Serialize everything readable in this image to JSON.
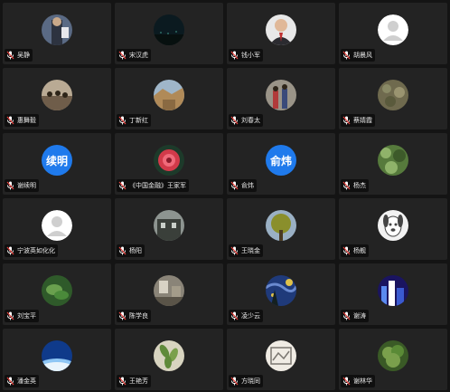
{
  "participants": [
    {
      "name": "吴静",
      "avatar": {
        "type": "photo",
        "icon": "person-photo",
        "bg": "#5a6a84",
        "fg": "#e8e8ec"
      }
    },
    {
      "name": "宋汉虎",
      "avatar": {
        "type": "photo",
        "icon": "night-scene",
        "bg": "#0b1a20",
        "fg": "#2d6b63"
      }
    },
    {
      "name": "钱小军",
      "avatar": {
        "type": "photo",
        "icon": "portrait",
        "bg": "#e8e8e8",
        "fg": "#2b2b30"
      }
    },
    {
      "name": "胡晨风",
      "avatar": {
        "type": "default",
        "icon": "default-person",
        "bg": "#ffffff",
        "fg": "#cfcfcf"
      }
    },
    {
      "name": "惠舞毅",
      "avatar": {
        "type": "photo",
        "icon": "crowd-photo",
        "bg": "#b9aa94",
        "fg": "#6f5d4a"
      }
    },
    {
      "name": "丁新红",
      "avatar": {
        "type": "photo",
        "icon": "landscape",
        "bg": "#9fb6c9",
        "fg": "#b08a58"
      }
    },
    {
      "name": "刘春太",
      "avatar": {
        "type": "photo",
        "icon": "people-photo",
        "bg": "#9a9488",
        "fg": "#b13a3a"
      }
    },
    {
      "name": "蔡婧霞",
      "avatar": {
        "type": "photo",
        "icon": "nature",
        "bg": "#6f6a4e",
        "fg": "#8a8a66"
      }
    },
    {
      "name": "谢续明",
      "avatar": {
        "type": "initials",
        "text": "续明",
        "bg": "#1f7aec",
        "fg": "#ffffff"
      }
    },
    {
      "name": "《中国金融》王家军",
      "avatar": {
        "type": "photo",
        "icon": "flower",
        "bg": "#1d3a2a",
        "fg": "#d23a4a"
      }
    },
    {
      "name": "俞炜",
      "avatar": {
        "type": "initials",
        "text": "俞炜",
        "bg": "#1f7aec",
        "fg": "#ffffff"
      }
    },
    {
      "name": "杨杰",
      "avatar": {
        "type": "photo",
        "icon": "foliage",
        "bg": "#567a3c",
        "fg": "#8fb36a"
      }
    },
    {
      "name": "宁波英如化化",
      "avatar": {
        "type": "default",
        "icon": "default-person",
        "bg": "#ffffff",
        "fg": "#cfcfcf"
      }
    },
    {
      "name": "杨阳",
      "avatar": {
        "type": "photo",
        "icon": "building",
        "bg": "#8d9490",
        "fg": "#3a3f3a"
      }
    },
    {
      "name": "王晓金",
      "avatar": {
        "type": "photo",
        "icon": "trees",
        "bg": "#9ab0c4",
        "fg": "#8a8f2c"
      }
    },
    {
      "name": "杨舰",
      "avatar": {
        "type": "photo",
        "icon": "cartoon-dog",
        "bg": "#f2f2f2",
        "fg": "#444444"
      }
    },
    {
      "name": "刘宝平",
      "avatar": {
        "type": "photo",
        "icon": "green-plant",
        "bg": "#2f5a2a",
        "fg": "#6aa04e"
      }
    },
    {
      "name": "陈学良",
      "avatar": {
        "type": "photo",
        "icon": "room",
        "bg": "#8a8478",
        "fg": "#d8d2c4"
      }
    },
    {
      "name": "凌少云",
      "avatar": {
        "type": "photo",
        "icon": "starry-night",
        "bg": "#1f3a7a",
        "fg": "#e0c24a"
      }
    },
    {
      "name": "谢涛",
      "avatar": {
        "type": "photo",
        "icon": "cityscape",
        "bg": "#1a1460",
        "fg": "#5a8af0"
      }
    },
    {
      "name": "潘金英",
      "avatar": {
        "type": "photo",
        "icon": "earth-horizon",
        "bg": "#0f3a8a",
        "fg": "#8ec6f4"
      }
    },
    {
      "name": "王艳芳",
      "avatar": {
        "type": "photo",
        "icon": "leaves",
        "bg": "#d8d4c0",
        "fg": "#5f8a3a"
      }
    },
    {
      "name": "方晓同",
      "avatar": {
        "type": "photo",
        "icon": "drawing",
        "bg": "#f0ece4",
        "fg": "#7a7670"
      }
    },
    {
      "name": "谢林华",
      "avatar": {
        "type": "photo",
        "icon": "shrub",
        "bg": "#3a5a26",
        "fg": "#7aa04c"
      }
    }
  ],
  "colors": {
    "background": "#141414",
    "tile": "#232323",
    "mic_red": "#e8413c"
  }
}
